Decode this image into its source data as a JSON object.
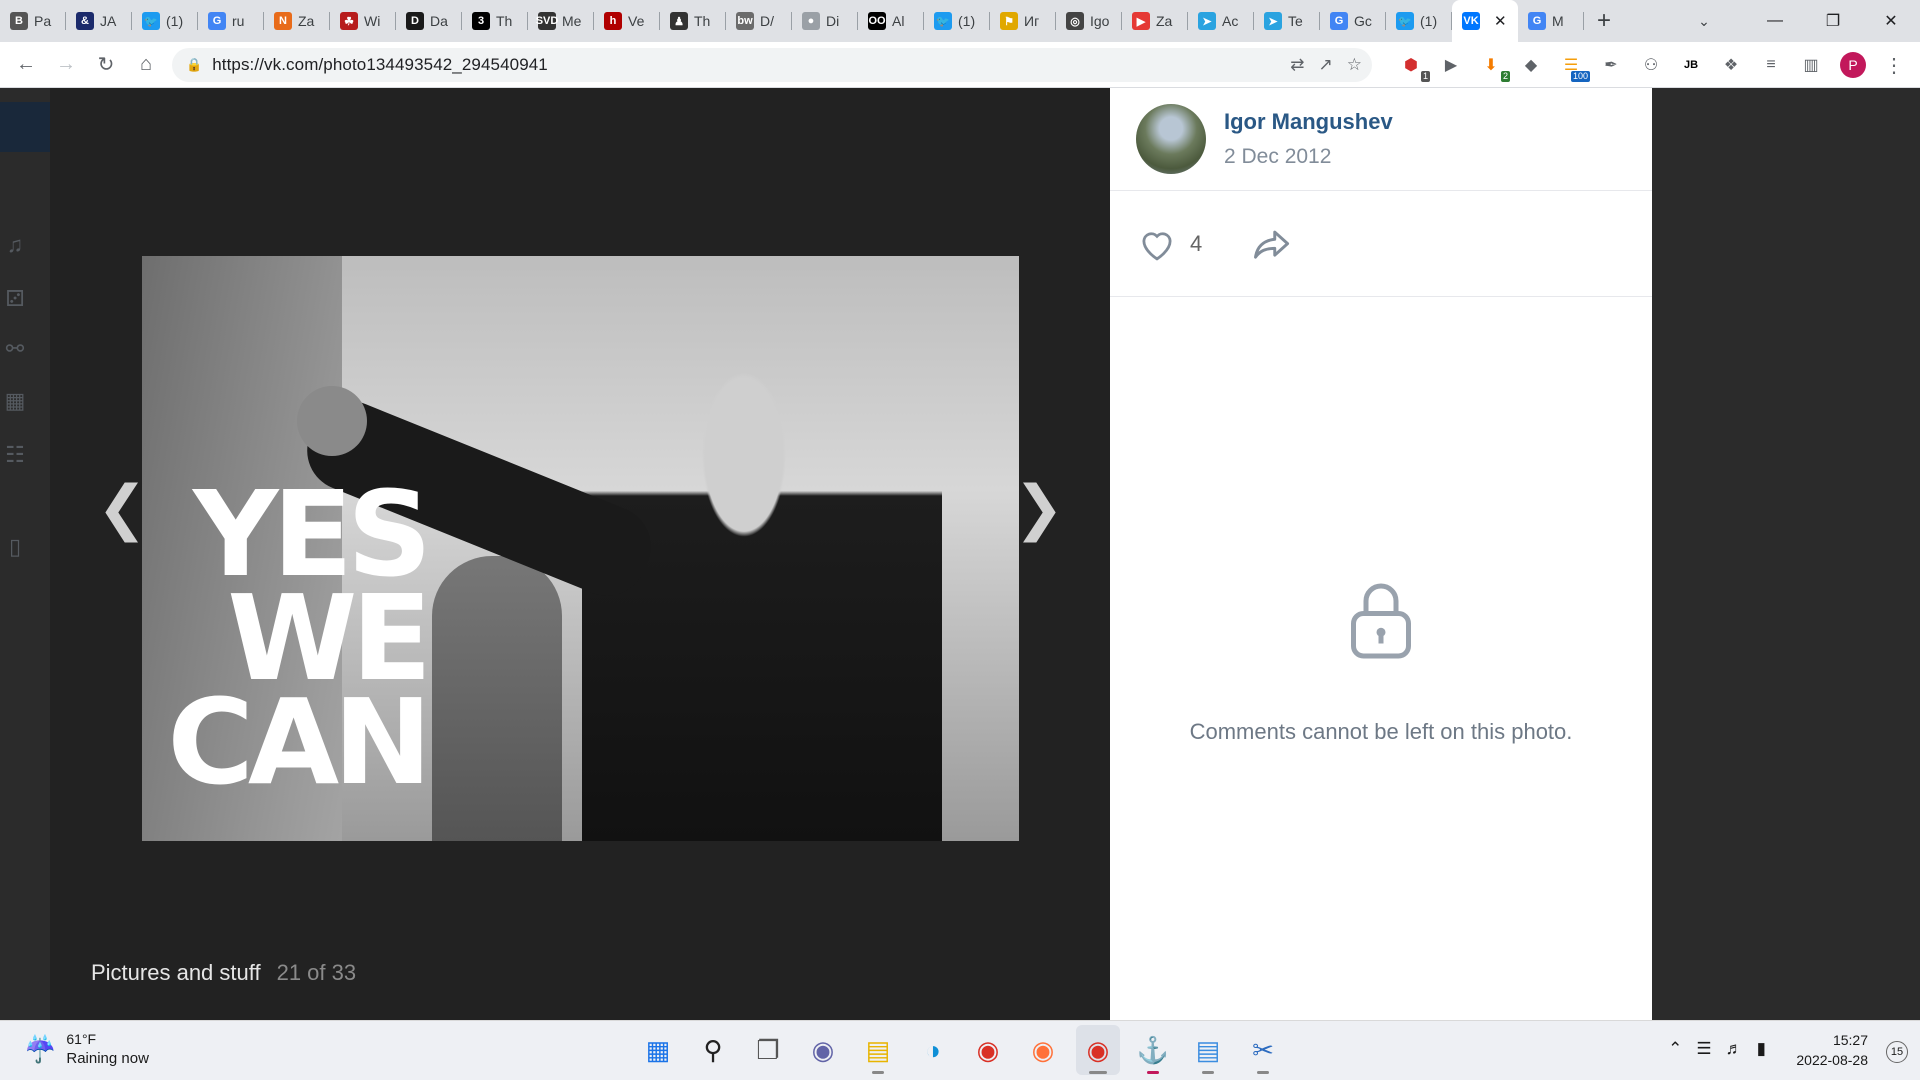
{
  "browser": {
    "tabs": [
      {
        "label": "Pa",
        "icon": "B",
        "color": "#555555"
      },
      {
        "label": "JA",
        "icon": "&",
        "color": "#1b2a6b"
      },
      {
        "label": "(1)",
        "icon": "twitter-icon",
        "color": "#1d9bf0"
      },
      {
        "label": "ru",
        "icon": "google-icon",
        "color": "#4285f4"
      },
      {
        "label": "Za",
        "icon": "N",
        "color": "#e86b1a"
      },
      {
        "label": "Wi",
        "icon": "crest-icon",
        "color": "#b71c1c"
      },
      {
        "label": "Da",
        "icon": "D",
        "color": "#1a1a1a"
      },
      {
        "label": "Th",
        "icon": "3",
        "color": "#000000"
      },
      {
        "label": "Me",
        "icon": "SVD",
        "color": "#333333"
      },
      {
        "label": "Ve",
        "icon": "h",
        "color": "#b00000"
      },
      {
        "label": "Th",
        "icon": "figure-icon",
        "color": "#333333"
      },
      {
        "label": "D/",
        "icon": "bw",
        "color": "#6b6b6b"
      },
      {
        "label": "Di",
        "icon": "circle-icon",
        "color": "#9aa0a6"
      },
      {
        "label": "Al",
        "icon": "OO",
        "color": "#000000"
      },
      {
        "label": "(1)",
        "icon": "twitter-icon",
        "color": "#1d9bf0"
      },
      {
        "label": "Иг",
        "icon": "flag-icon",
        "color": "#e0a800"
      },
      {
        "label": "Igo",
        "icon": "globe-icon",
        "color": "#444444"
      },
      {
        "label": "Za",
        "icon": "play-icon",
        "color": "#e53935"
      },
      {
        "label": "Ac",
        "icon": "telegram-icon",
        "color": "#2aa3e0"
      },
      {
        "label": "Te",
        "icon": "telegram-icon",
        "color": "#2aa3e0"
      },
      {
        "label": "Gc",
        "icon": "translate-icon",
        "color": "#4285f4"
      },
      {
        "label": "(1)",
        "icon": "twitter-icon",
        "color": "#1d9bf0"
      }
    ],
    "active_tab": {
      "label": "",
      "icon": "vk-icon",
      "color": "#0077ff"
    },
    "last_tab": {
      "label": "M",
      "icon": "google-icon",
      "color": "#4285f4"
    },
    "new_tab": "+",
    "url": "https://vk.com/photo134493542_294540941",
    "extensions": [
      {
        "name": "adblock-icon",
        "badge": "1",
        "badge_color": "#555555"
      },
      {
        "name": "play-circle-icon",
        "badge": "",
        "badge_color": ""
      },
      {
        "name": "download-icon",
        "badge": "2",
        "badge_color": "#2e7d32"
      },
      {
        "name": "shield-icon",
        "badge": "",
        "badge_color": ""
      },
      {
        "name": "rss-icon",
        "badge": "100",
        "badge_color": "#1565c0"
      },
      {
        "name": "tag-icon",
        "badge": "",
        "badge_color": ""
      },
      {
        "name": "people-icon",
        "badge": "",
        "badge_color": ""
      },
      {
        "name": "jb-icon",
        "badge": "",
        "badge_color": ""
      },
      {
        "name": "puzzle-icon",
        "badge": "",
        "badge_color": ""
      },
      {
        "name": "playlist-icon",
        "badge": "",
        "badge_color": ""
      },
      {
        "name": "sidepanel-icon",
        "badge": "",
        "badge_color": ""
      }
    ],
    "profile_initial": "P"
  },
  "viewer": {
    "slogan": [
      "YES",
      "WE",
      "CAN"
    ],
    "album_name": "Pictures and stuff",
    "position": "21 of 33"
  },
  "panel": {
    "author": "Igor Mangushev",
    "date": "2 Dec 2012",
    "likes": "4",
    "comments_disabled": "Comments cannot be left on this photo."
  },
  "taskbar": {
    "temp": "61°F",
    "weather": "Raining now",
    "time": "15:27",
    "date": "2022-08-28",
    "notifications": "15"
  },
  "colors": {
    "vk_link": "#2a5885",
    "vk_muted": "#818c99",
    "viewer_bg": "#222222"
  }
}
